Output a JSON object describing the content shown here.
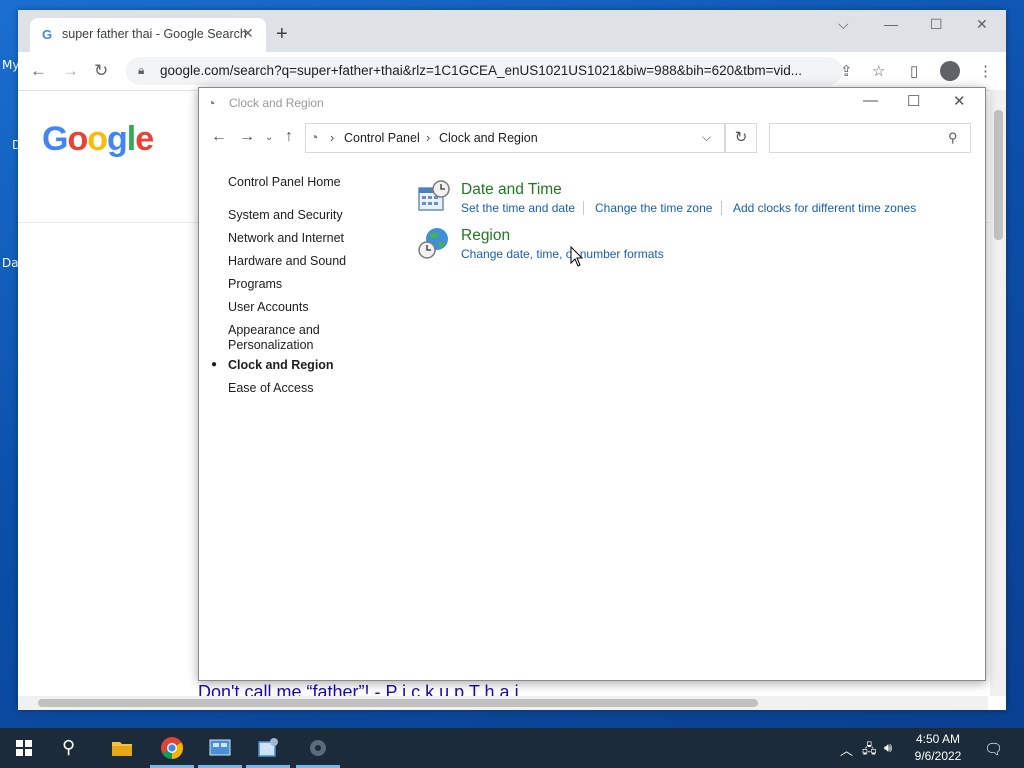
{
  "desktop": {
    "fragments": [
      "My",
      "D",
      "Da"
    ]
  },
  "chrome": {
    "tab": {
      "title": "super father thai - Google Search",
      "close": "✕"
    },
    "new_tab": "+",
    "window_controls": {
      "menu": "⌵",
      "minimize": "—",
      "maximize": "☐",
      "close": "✕"
    },
    "url": "google.com/search?q=super+father+thai&rlz=1C1GCEA_enUS1021US1021&biw=988&bih=620&tbm=vid...",
    "page": {
      "logo_letters": [
        "G",
        "o",
        "o",
        "g",
        "l",
        "e"
      ],
      "logo_colors": [
        "#4285f4",
        "#ea4335",
        "#fbbc05",
        "#4285f4",
        "#34a853",
        "#ea4335"
      ],
      "snippet": "Don't call me “father”! - P i c k u p T h a i"
    }
  },
  "control_panel": {
    "window_title": "Clock and Region",
    "breadcrumb": [
      "Control Panel",
      "Clock and Region"
    ],
    "search_placeholder": "",
    "sidebar": {
      "home": "Control Panel Home",
      "items": [
        "System and Security",
        "Network and Internet",
        "Hardware and Sound",
        "Programs",
        "User Accounts",
        "Appearance and",
        "Personalization",
        "Clock and Region",
        "Ease of Access"
      ]
    },
    "categories": [
      {
        "title": "Date and Time",
        "icon": "calendar-clock-icon",
        "links": [
          "Set the time and date",
          "Change the time zone",
          "Add clocks for different time zones"
        ]
      },
      {
        "title": "Region",
        "icon": "globe-clock-icon",
        "links": [
          "Change date, time, or number formats"
        ]
      }
    ]
  },
  "taskbar": {
    "time": "4:50 AM",
    "date": "9/6/2022",
    "accent": "#76b9ed"
  }
}
